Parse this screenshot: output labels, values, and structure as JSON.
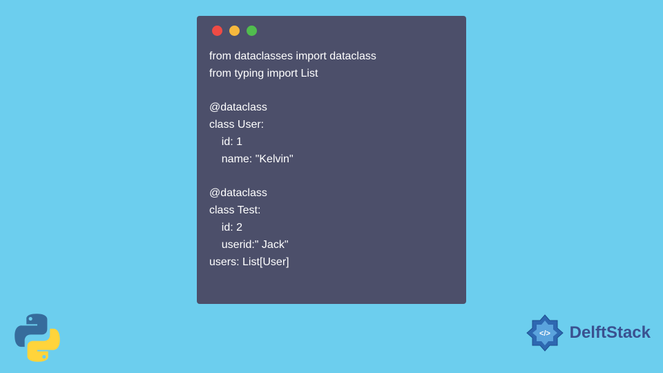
{
  "code": {
    "lines": [
      "from dataclasses import dataclass",
      "from typing import List",
      "",
      "@dataclass",
      "class User:",
      "    id: 1",
      "    name: \"Kelvin\"",
      "",
      "@dataclass",
      "class Test:",
      "    id: 2",
      "    userid:\" Jack\"",
      "users: List[User]"
    ]
  },
  "brand": {
    "name": "DelftStack"
  },
  "colors": {
    "background": "#6cceee",
    "window": "#4c4f6a",
    "dot_red": "#ef4b45",
    "dot_yellow": "#f6b83d",
    "dot_green": "#51bd4e",
    "brand_text": "#3a5190"
  }
}
